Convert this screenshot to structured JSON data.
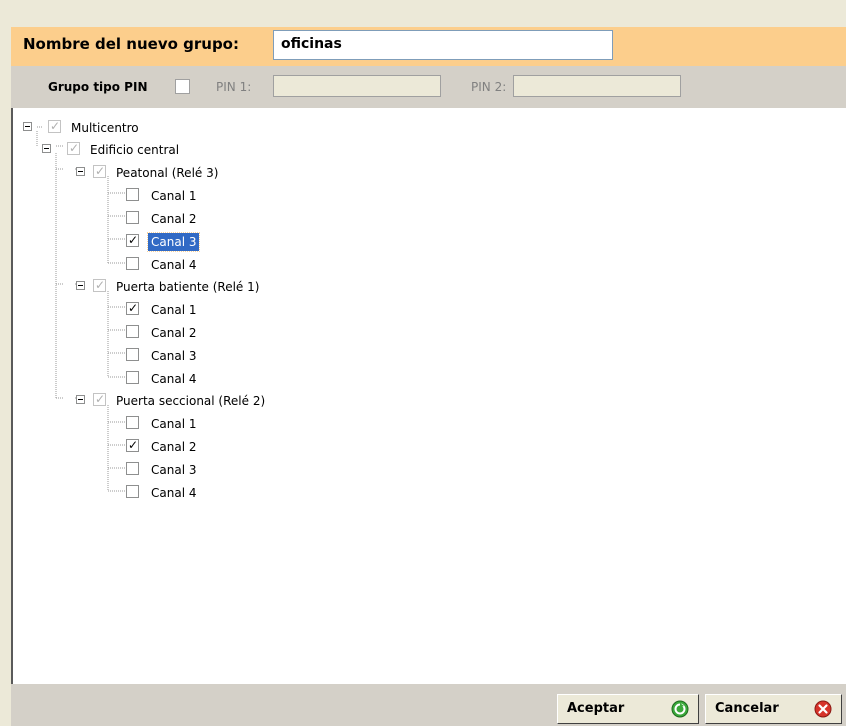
{
  "header": {
    "label": "Nombre del nuevo grupo:",
    "group_name": "oficinas"
  },
  "pin": {
    "label": "Grupo tipo PIN",
    "pin1_label": "PIN 1:",
    "pin2_label": "PIN 2:",
    "pin1_value": "",
    "pin2_value": ""
  },
  "tree": {
    "root": "Multicentro",
    "building": "Edificio central",
    "doors": [
      {
        "label": "Peatonal (Relé 3)",
        "channels": [
          {
            "label": "Canal 1",
            "checked": false
          },
          {
            "label": "Canal 2",
            "checked": false
          },
          {
            "label": "Canal 3",
            "checked": true,
            "selected": true
          },
          {
            "label": "Canal 4",
            "checked": false
          }
        ]
      },
      {
        "label": "Puerta batiente (Relé 1)",
        "channels": [
          {
            "label": "Canal 1",
            "checked": true
          },
          {
            "label": "Canal 2",
            "checked": false
          },
          {
            "label": "Canal 3",
            "checked": false
          },
          {
            "label": "Canal 4",
            "checked": false
          }
        ]
      },
      {
        "label": "Puerta seccional (Relé 2)",
        "channels": [
          {
            "label": "Canal 1",
            "checked": false
          },
          {
            "label": "Canal 2",
            "checked": true
          },
          {
            "label": "Canal 3",
            "checked": false
          },
          {
            "label": "Canal 4",
            "checked": false
          }
        ]
      }
    ]
  },
  "footer": {
    "accept_label": "Aceptar",
    "cancel_label": "Cancelar",
    "accept_icon": "green-confirm-icon",
    "cancel_icon": "red-cancel-icon"
  },
  "colors": {
    "header_bg": "#fcce8c",
    "selection": "#316ac5",
    "accept_green": "#3aa83a",
    "cancel_red": "#d6332a"
  }
}
